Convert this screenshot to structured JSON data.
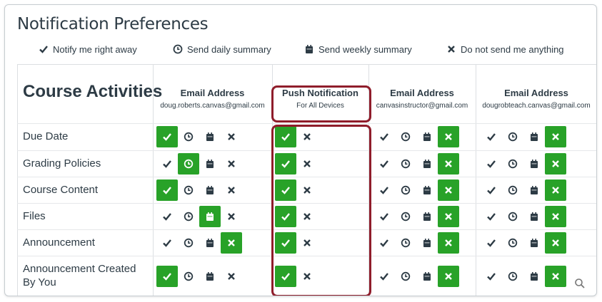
{
  "page": {
    "title": "Notification Preferences",
    "course_heading": "Course Activities"
  },
  "legend": [
    {
      "icon": "check-icon",
      "label": "Notify me right away"
    },
    {
      "icon": "clock-icon",
      "label": "Send daily summary"
    },
    {
      "icon": "calendar-icon",
      "label": "Send weekly summary"
    },
    {
      "icon": "x-icon",
      "label": "Do not send me anything"
    }
  ],
  "columns": [
    {
      "header": "Email Address",
      "sub": "doug.roberts.canvas@gmail.com",
      "type": "email"
    },
    {
      "header": "Push Notification",
      "sub": "For All Devices",
      "type": "push"
    },
    {
      "header": "Email Address",
      "sub": "canvasinstructor@gmail.com",
      "type": "email"
    },
    {
      "header": "Email Address",
      "sub": "dougrobteach.canvas@gmail.com",
      "type": "email"
    }
  ],
  "rows": [
    {
      "label": "Due Date",
      "selected": [
        "now",
        "now",
        "never",
        "never"
      ]
    },
    {
      "label": "Grading Policies",
      "selected": [
        "daily",
        "now",
        "never",
        "never"
      ]
    },
    {
      "label": "Course Content",
      "selected": [
        "now",
        "now",
        "never",
        "never"
      ]
    },
    {
      "label": "Files",
      "selected": [
        "weekly",
        "now",
        "never",
        "never"
      ]
    },
    {
      "label": "Announcement",
      "selected": [
        "never",
        "now",
        "never",
        "never"
      ]
    },
    {
      "label": "Announcement Created By You",
      "selected": [
        "now",
        "now",
        "never",
        "never"
      ]
    }
  ],
  "colors": {
    "selected": "#28a228",
    "highlight": "#8f1d2b",
    "text": "#2d3b45"
  }
}
